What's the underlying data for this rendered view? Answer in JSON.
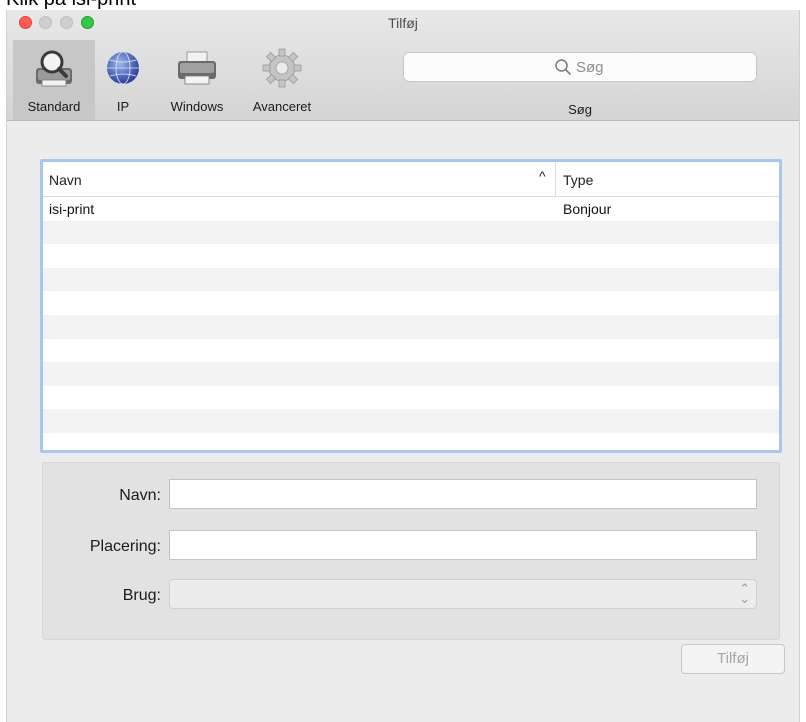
{
  "caption": "Klik på isi-print",
  "window": {
    "title": "Tilføj"
  },
  "toolbar": {
    "items": [
      {
        "label": "Standard",
        "icon": "magnifier-printer-icon",
        "selected": true
      },
      {
        "label": "IP",
        "icon": "globe-icon",
        "selected": false
      },
      {
        "label": "Windows",
        "icon": "printer-icon",
        "selected": false
      },
      {
        "label": "Avanceret",
        "icon": "gear-icon",
        "selected": false
      }
    ],
    "search": {
      "placeholder": "Søg",
      "label": "Søg"
    }
  },
  "printer_list": {
    "columns": {
      "name": "Navn",
      "type": "Type",
      "sort": "ascending"
    },
    "rows": [
      {
        "name": "isi-print",
        "type": "Bonjour"
      }
    ]
  },
  "form": {
    "name_label": "Navn:",
    "location_label": "Placering:",
    "use_label": "Brug:",
    "name_value": "",
    "location_value": "",
    "use_value": ""
  },
  "buttons": {
    "add": "Tilføj"
  },
  "colors": {
    "selection_border": "#a9c7ec",
    "close": "#fc5b57",
    "zoom": "#34c84a"
  }
}
